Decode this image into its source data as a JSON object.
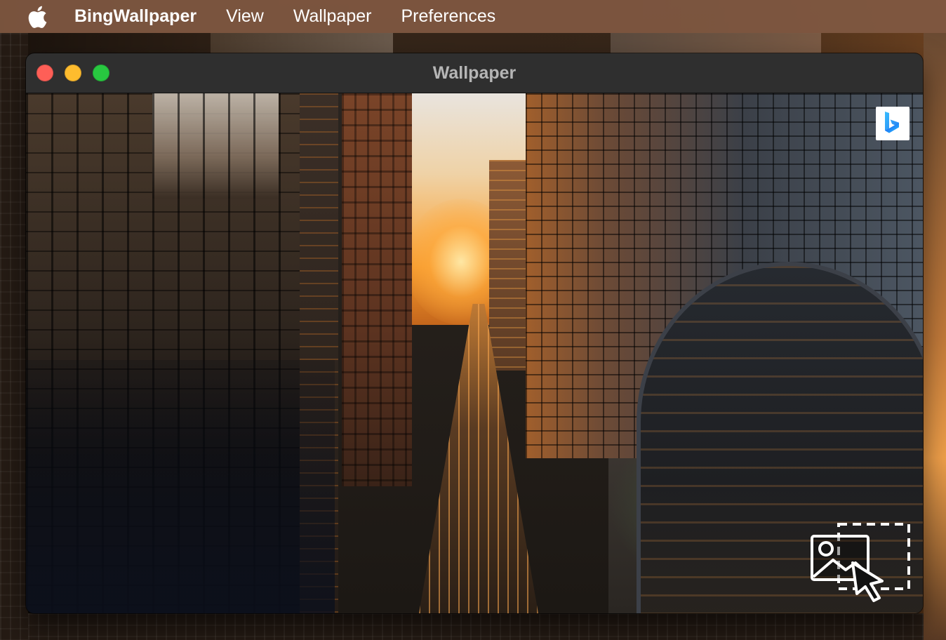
{
  "menubar": {
    "app_name": "BingWallpaper",
    "items": [
      {
        "label": "View"
      },
      {
        "label": "Wallpaper"
      },
      {
        "label": "Preferences"
      }
    ]
  },
  "window": {
    "title": "Wallpaper"
  },
  "icons": {
    "apple": "apple-logo-icon",
    "bing": "bing-logo-icon",
    "set_wallpaper": "set-wallpaper-icon"
  },
  "colors": {
    "menubar_bg": "#805842",
    "titlebar_bg": "#2f2f2f",
    "title_text": "#b5b5b5",
    "close": "#fe5f57",
    "minimize": "#febc2e",
    "zoom": "#28c840"
  }
}
